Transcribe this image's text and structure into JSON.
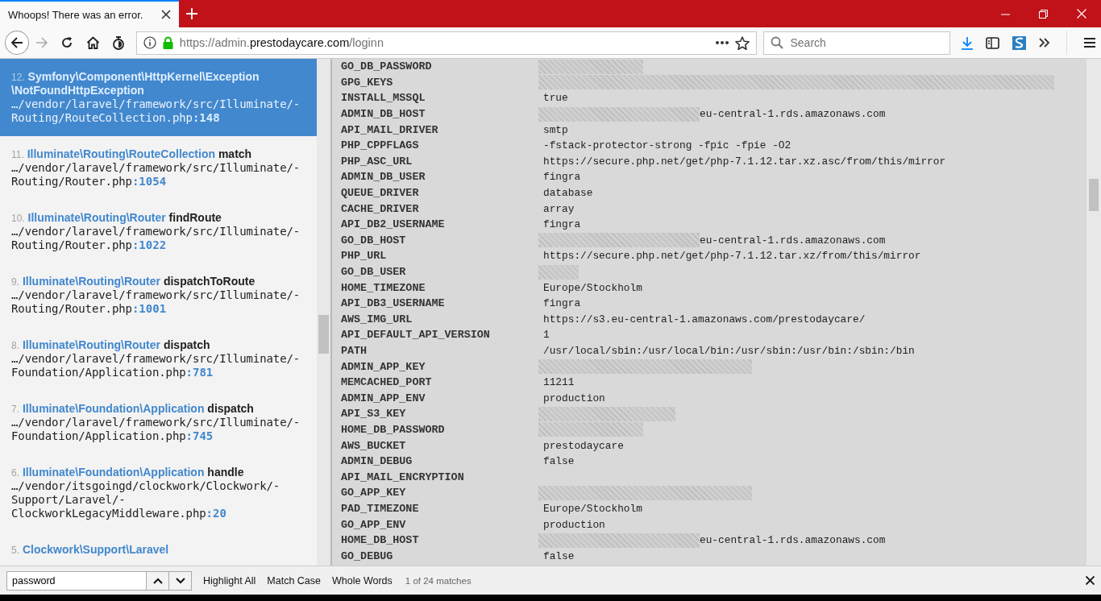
{
  "tabs": [
    {
      "title": "Whoops! There was an error.",
      "selected": true
    }
  ],
  "nav": {
    "forward_disabled": true,
    "url": {
      "prefix": "https://admin.",
      "domain": "prestodaycare.com",
      "path": "/loginn"
    },
    "search": {
      "placeholder": "Search"
    }
  },
  "frames": [
    {
      "number": "12.",
      "class_lines": [
        "Symfony\\Component\\HttpKernel\\Exception",
        "\\NotFoundHttpException"
      ],
      "path_lines": [
        "…/vendor/laravel/framework/src/Illuminate/-",
        "Routing/RouteCollection.php"
      ],
      "line": ":148",
      "selected": true
    },
    {
      "number": "11.",
      "class_lines": [
        "Illuminate\\Routing\\RouteCollection"
      ],
      "method": "match",
      "path_lines": [
        "…/vendor/laravel/framework/src/Illuminate/-",
        "Routing/Router.php"
      ],
      "line": ":1054",
      "selected": false
    },
    {
      "number": "10.",
      "class_lines": [
        "Illuminate\\Routing\\Router"
      ],
      "method": "findRoute",
      "path_lines": [
        "…/vendor/laravel/framework/src/Illuminate/-",
        "Routing/Router.php"
      ],
      "line": ":1022",
      "selected": false
    },
    {
      "number": "9.",
      "class_lines": [
        "Illuminate\\Routing\\Router"
      ],
      "method": "dispatchToRoute",
      "path_lines": [
        "…/vendor/laravel/framework/src/Illuminate/-",
        "Routing/Router.php"
      ],
      "line": ":1001",
      "selected": false
    },
    {
      "number": "8.",
      "class_lines": [
        "Illuminate\\Routing\\Router"
      ],
      "method": "dispatch",
      "path_lines": [
        "…/vendor/laravel/framework/src/Illuminate/-",
        "Foundation/Application.php"
      ],
      "line": ":781",
      "selected": false
    },
    {
      "number": "7.",
      "class_lines": [
        "Illuminate\\Foundation\\Application"
      ],
      "method": "dispatch",
      "path_lines": [
        "…/vendor/laravel/framework/src/Illuminate/-",
        "Foundation/Application.php"
      ],
      "line": ":745",
      "selected": false
    },
    {
      "number": "6.",
      "class_lines": [
        "Illuminate\\Foundation\\Application"
      ],
      "method": "handle",
      "path_lines": [
        "…/vendor/itsgoingd/clockwork/Clockwork/-",
        "Support/Laravel/-",
        "ClockworkLegacyMiddleware.php"
      ],
      "line": ":20",
      "selected": false
    },
    {
      "number": "5.",
      "class_lines": [
        "Clockwork\\Support\\Laravel"
      ],
      "selected": false
    }
  ],
  "env_rows": [
    {
      "key": "GO_DB_PASSWORD",
      "redacted": true,
      "kind": "short"
    },
    {
      "key": "GPG_KEYS",
      "redacted": true,
      "kind": "long"
    },
    {
      "key": "INSTALL_MSSQL",
      "value": "true"
    },
    {
      "key": "ADMIN_DB_HOST",
      "redacted": true,
      "kind": "host",
      "value": "eu-central-1.rds.amazonaws.com"
    },
    {
      "key": "API_MAIL_DRIVER",
      "value": "smtp"
    },
    {
      "key": "PHP_CPPFLAGS",
      "value": "-fstack-protector-strong -fpic -fpie -O2"
    },
    {
      "key": "PHP_ASC_URL",
      "value": "https://secure.php.net/get/php-7.1.12.tar.xz.asc/from/this/mirror"
    },
    {
      "key": "ADMIN_DB_USER",
      "value": "fingra"
    },
    {
      "key": "QUEUE_DRIVER",
      "value": "database"
    },
    {
      "key": "CACHE_DRIVER",
      "value": "array"
    },
    {
      "key": "API_DB2_USERNAME",
      "value": "fingra"
    },
    {
      "key": "GO_DB_HOST",
      "redacted": true,
      "kind": "host",
      "value": "eu-central-1.rds.amazonaws.com"
    },
    {
      "key": "PHP_URL",
      "value": "https://secure.php.net/get/php-7.1.12.tar.xz/from/this/mirror"
    },
    {
      "key": "GO_DB_USER",
      "redacted": true,
      "kind": "tiny"
    },
    {
      "key": "HOME_TIMEZONE",
      "value": "Europe/Stockholm"
    },
    {
      "key": "API_DB3_USERNAME",
      "value": "fingra"
    },
    {
      "key": "AWS_IMG_URL",
      "value": "https://s3.eu-central-1.amazonaws.com/prestodaycare/"
    },
    {
      "key": "API_DEFAULT_API_VERSION",
      "value": "1"
    },
    {
      "key": "PATH",
      "value": "/usr/local/sbin:/usr/local/bin:/usr/sbin:/usr/bin:/sbin:/bin"
    },
    {
      "key": "ADMIN_APP_KEY",
      "redacted": true,
      "kind": "key"
    },
    {
      "key": "MEMCACHED_PORT",
      "value": "11211"
    },
    {
      "key": "ADMIN_APP_ENV",
      "value": "production"
    },
    {
      "key": "API_S3_KEY",
      "redacted": true,
      "kind": "medium"
    },
    {
      "key": "HOME_DB_PASSWORD",
      "redacted": true,
      "kind": "short"
    },
    {
      "key": "AWS_BUCKET",
      "value": "prestodaycare"
    },
    {
      "key": "ADMIN_DEBUG",
      "value": "false"
    },
    {
      "key": "API_MAIL_ENCRYPTION"
    },
    {
      "key": "GO_APP_KEY",
      "redacted": true,
      "kind": "key"
    },
    {
      "key": "PAD_TIMEZONE",
      "value": "Europe/Stockholm"
    },
    {
      "key": "GO_APP_ENV",
      "value": "production"
    },
    {
      "key": "HOME_DB_HOST",
      "redacted": true,
      "kind": "host",
      "value": "eu-central-1.rds.amazonaws.com"
    },
    {
      "key": "GO_DEBUG",
      "value": "false"
    }
  ],
  "find_bar": {
    "value": "password",
    "options": [
      "Highlight All",
      "Match Case",
      "Whole Words"
    ],
    "status": "1 of 24 matches"
  }
}
